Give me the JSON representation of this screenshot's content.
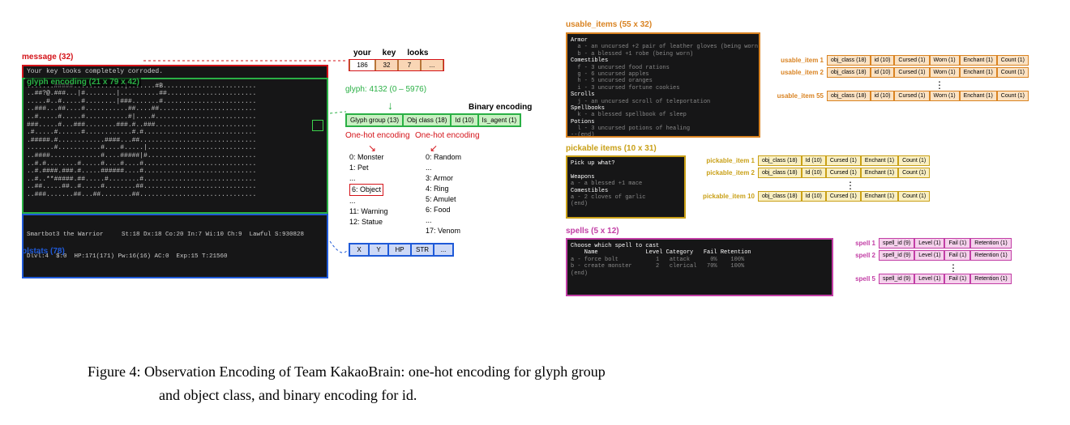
{
  "colors": {
    "red": "#d41319",
    "green": "#2ab045",
    "blue": "#1f5ad8",
    "orange": "#d98322",
    "yellow": "#c9a017",
    "pink": "#c23ea5"
  },
  "left": {
    "message_label": "message (32)",
    "message_text": "Your key looks completely corroded.",
    "glyph_label": "glyph encoding (21 x 79 x 42)",
    "map_ascii": ".......#####.............|.......#B........................\n..##?@.###...|#........|..........##.......................\n.....#..#.....#........|###.......#........................\n..###...##....#...........##....##.........................\n..#.....#.....#...........#|....#..........................\n###.....#...###........###.#..###..........................\n.#.....#......#............#.#.............................\n.#####.#............####...##..............................\n.......#...........#....#.....|............................\n..####.............#....#####|#............................\n..#.#........#.....#....#....#.............................\n..#.####.###.#.....######....#.............................\n..#..**#####.##.....#........#.............................\n..##.....##..#.....#........##.............................\n..###.......##...##........##..............................",
    "status1": "Smartbot3 the Warrior     St:18 Dx:18 Co:20 In:7 Wi:10 Ch:9  Lawful S:930828",
    "status2": "Dlvl:4  $:0  HP:171(171) Pw:16(16) AC:0  Exp:15 T:21560",
    "blstats_label": "blstats (78)",
    "key_example": {
      "labels": [
        "your",
        "key",
        "looks"
      ],
      "values": [
        "186",
        "32",
        "7",
        "..."
      ],
      "arrow_note": "glyph: 4132 (0 – 5976)"
    },
    "glyph_group_pills": [
      "Glyph group (13)",
      "Obj class (18)",
      "Id (10)",
      "Is_agent (1)"
    ],
    "binary_enc_label": "Binary encoding",
    "onehot1": "One-hot encoding",
    "onehot2": "One-hot encoding",
    "glyph_groups_left": [
      "0: Monster",
      "1: Pet",
      "...",
      "6: Object",
      "...",
      "11: Warning",
      "12: Statue"
    ],
    "glyph_groups_right": [
      "0: Random",
      "...",
      "3: Armor",
      "4: Ring",
      "5: Amulet",
      "6: Food",
      "...",
      "17: Venom"
    ],
    "bl_pills": [
      "X",
      "Y",
      "HP",
      "STR",
      "..."
    ]
  },
  "usable": {
    "label": "usable_items (55 x 32)",
    "term_lines": [
      "Armor",
      "  a - an uncursed +2 pair of leather gloves (being worn)",
      "  b - a blessed +1 robe (being worn)",
      "Comestibles",
      "  f - 3 uncursed food rations",
      "  g - 6 uncursed apples",
      "  h - 5 uncursed oranges",
      "  i - 3 uncursed fortune cookies",
      "Scrolls",
      "  j - an uncursed scroll of teleportation",
      "Spellbooks",
      "  k - a blessed spellbook of sleep",
      "Potions",
      "  l - 3 uncursed potions of healing",
      "--(end)"
    ],
    "row_labels": [
      "usable_item 1",
      "usable_item 2",
      "usable_item 55"
    ],
    "pills": [
      "obj_class (18)",
      "id (10)",
      "Cursed (1)",
      "Worn (1)",
      "Enchant (1)",
      "Count (1)"
    ]
  },
  "pickable": {
    "label": "pickable items (10 x 31)",
    "term_lines": [
      "Pick up what?",
      "",
      "Weapons",
      "a - a blessed +1 mace",
      "Comestibles",
      "a - 2 cloves of garlic",
      "(end)"
    ],
    "row_labels": [
      "pickable_item 1",
      "pickable_item 2",
      "pickable_item 10"
    ],
    "pills": [
      "obj_class (18)",
      "Id (10)",
      "Cursed (1)",
      "Enchant (1)",
      "Count (1)"
    ]
  },
  "spells": {
    "label": "spells (5 x 12)",
    "term_title": "Choose which spell to cast",
    "term_header": "    Name              Level Category   Fail Retention",
    "term_rows": [
      "a - force bolt           1   attack      0%    100%",
      "b - create monster       2   clerical   70%    100%"
    ],
    "term_end": "(end)",
    "row_labels": [
      "spell 1",
      "spell 2",
      "spell 5"
    ],
    "pills": [
      "spell_id (9)",
      "Level (1)",
      "Fail (1)",
      "Retention (1)"
    ]
  },
  "caption": "Figure 4: Observation Encoding of Team KakaoBrain: one-hot encoding for glyph group and object class, and binary encoding for id."
}
